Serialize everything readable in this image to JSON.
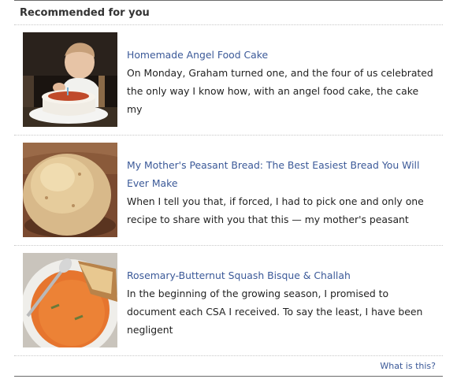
{
  "widget": {
    "title": "Recommended for you",
    "footer_link": "What is this?",
    "items": [
      {
        "title": "Homemade Angel Food Cake",
        "excerpt": "On Monday, Graham turned one, and the four of us celebrated the only way I know how, with an angel food cake, the cake my",
        "thumbnail": "baby-with-cake-photo"
      },
      {
        "title": "My Mother's Peasant Bread: The Best Easiest Bread You Will Ever Make",
        "excerpt": "When I tell you that, if forced, I had to pick one and only one recipe to share with you that this — my mother's peasant",
        "thumbnail": "round-bread-loaf-photo"
      },
      {
        "title": "Rosemary-Butternut Squash Bisque & Challah",
        "excerpt": "In the beginning of the growing season, I promised to document each CSA I received. To say the least, I have been negligent",
        "thumbnail": "squash-soup-bowl-photo"
      }
    ]
  }
}
